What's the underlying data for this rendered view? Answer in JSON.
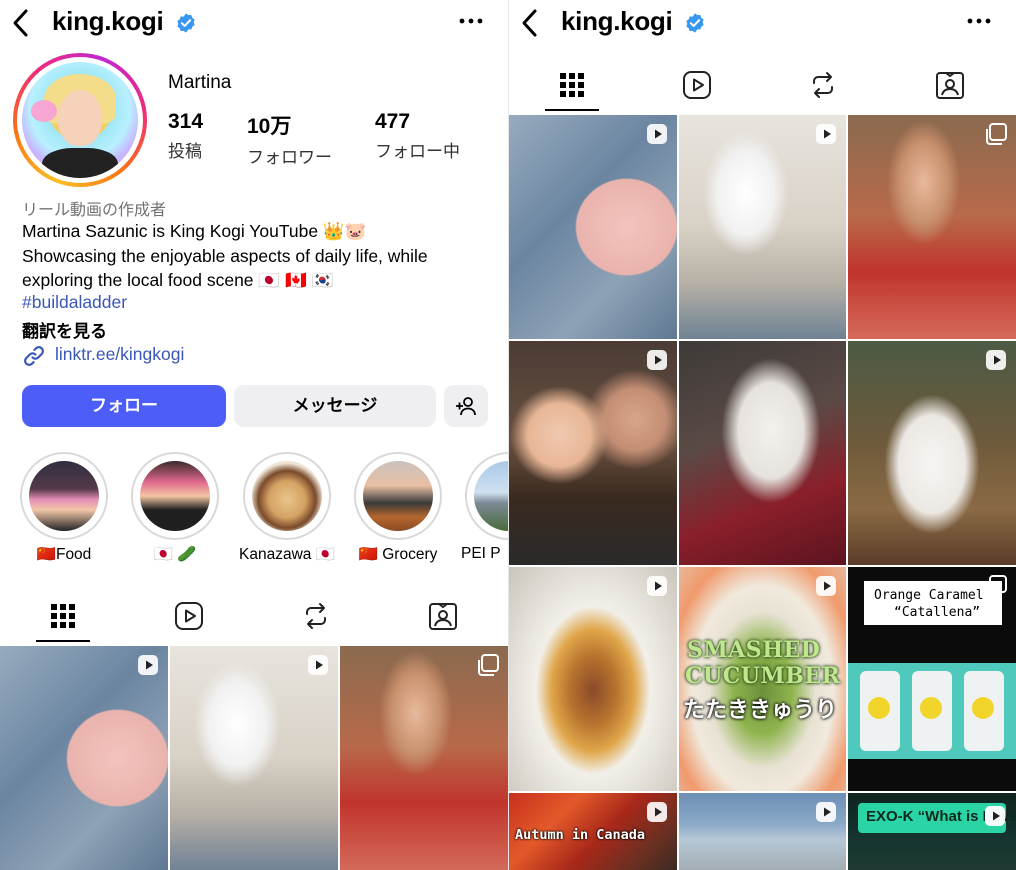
{
  "profile": {
    "username": "king.kogi",
    "display_name": "Martina",
    "stats": [
      {
        "value": "314",
        "label": "投稿"
      },
      {
        "value": "10万",
        "label": "フォロワー"
      },
      {
        "value": "477",
        "label": "フォロー中"
      }
    ],
    "category": "リール動画の作成者",
    "bio_lines": [
      "Martina Sazunic is King Kogi YouTube 👑🐷",
      "Showcasing the enjoyable aspects of daily life, while",
      "exploring the local food scene 🇯🇵 🇨🇦 🇰🇷"
    ],
    "hashtag": "#buildaladder",
    "translate_label": "翻訳を見る",
    "link": "linktr.ee/kingkogi"
  },
  "actions": {
    "follow_label": "フォロー",
    "message_label": "メッセージ",
    "add_icon": "add-person-icon"
  },
  "highlights": [
    {
      "label": "🇨🇳Food"
    },
    {
      "label": "🇯🇵 🥒"
    },
    {
      "label": "Kanazawa 🇯🇵"
    },
    {
      "label": "🇨🇳 Grocery"
    },
    {
      "label": "PEI P"
    }
  ],
  "tabs": [
    {
      "name": "grid",
      "icon": "grid-icon",
      "active": true
    },
    {
      "name": "reels",
      "icon": "reels-icon",
      "active": false
    },
    {
      "name": "reposts",
      "icon": "repost-icon",
      "active": false
    },
    {
      "name": "tagged",
      "icon": "tagged-icon",
      "active": false
    }
  ],
  "grid_posts": [
    {
      "subject": "manicured nails on blue fur",
      "badge": "reel"
    },
    {
      "subject": "white and grey cat",
      "badge": "reel"
    },
    {
      "subject": "vintage family photo",
      "badge": "carousel"
    },
    {
      "subject": "selfie with beers",
      "badge": "reel"
    },
    {
      "subject": "cat lying down",
      "badge": "none"
    },
    {
      "subject": "cat sitting upright",
      "badge": "reel"
    },
    {
      "subject": "stir fried noodles",
      "badge": "reel",
      "overlay": ""
    },
    {
      "subject": "smashed cucumber salad",
      "badge": "reel",
      "overlay_lines": [
        "SMASHED",
        "CUCUMBER",
        "たたききゅうり"
      ]
    },
    {
      "subject": "candy packages",
      "badge": "carousel",
      "overlay_lines": [
        "Orange Caramel",
        "“Catallena”"
      ]
    },
    {
      "subject": "autumn trees",
      "badge": "reel",
      "overlay_lines": [
        "Autumn in Canada"
      ]
    },
    {
      "subject": "mountain landscape",
      "badge": "reel"
    },
    {
      "subject": "music video",
      "badge": "reel",
      "overlay_lines": [
        "EXO-K “What is Love”"
      ]
    }
  ],
  "colors": {
    "follow_button": "#4c5ef7",
    "link_text": "#3a57b7",
    "secondary_button": "#efeff1",
    "verified_badge": "#3897f0"
  }
}
